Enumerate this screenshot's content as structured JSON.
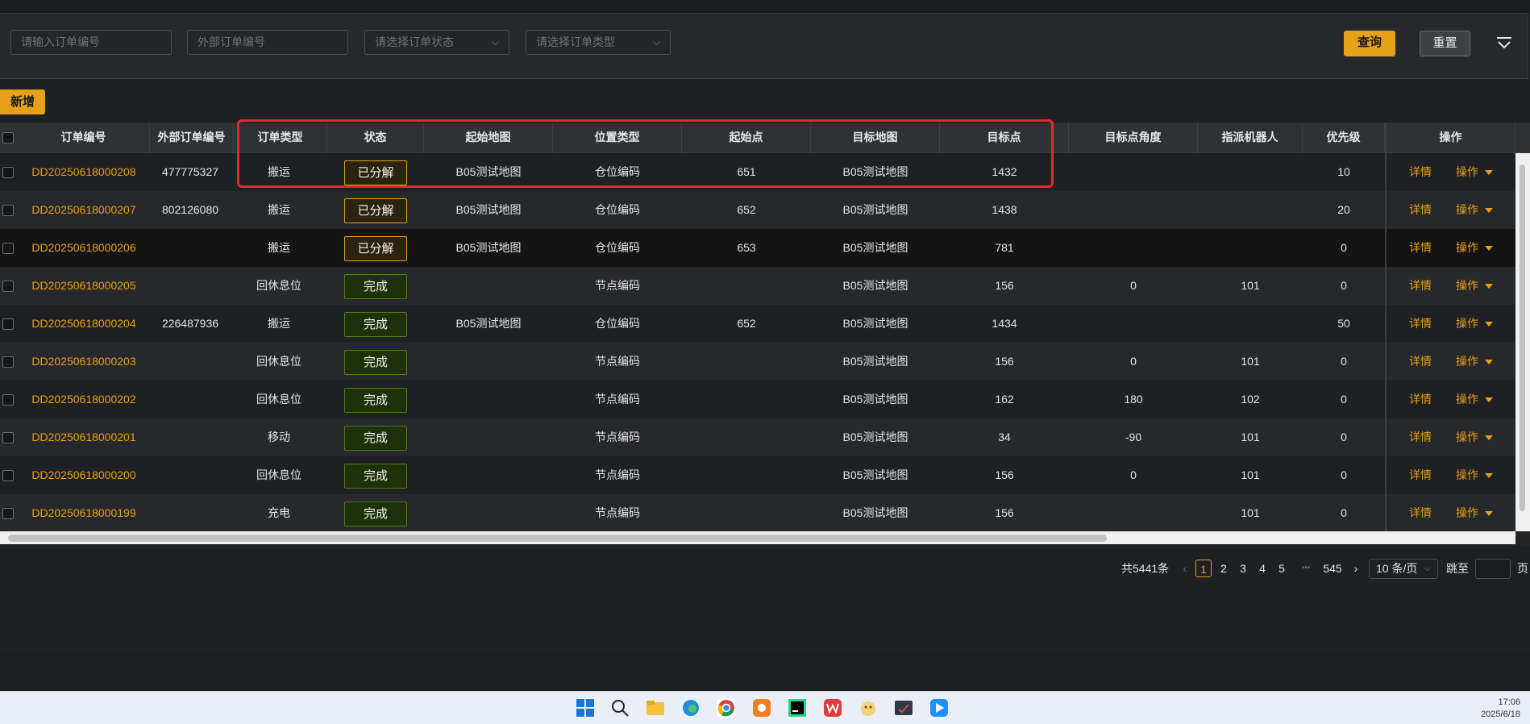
{
  "filter": {
    "order_no_placeholder": "请输入订单编号",
    "ext_order_placeholder": "外部订单编号",
    "status_placeholder": "请选择订单状态",
    "type_placeholder": "请选择订单类型",
    "query_label": "查询",
    "reset_label": "重置"
  },
  "toolbar": {
    "add_label": "新增"
  },
  "table": {
    "headers": [
      "订单编号",
      "外部订单编号",
      "订单类型",
      "状态",
      "起始地图",
      "位置类型",
      "起始点",
      "目标地图",
      "目标点",
      "目标点角度",
      "指派机器人",
      "优先级",
      "操作"
    ],
    "detail_label": "详情",
    "action_label": "操作",
    "rows": [
      {
        "id": "DD20250618000208",
        "ext": "477775327",
        "type": "搬运",
        "status": "已分解",
        "start_map": "B05测试地图",
        "pos_type": "仓位编码",
        "start": "651",
        "target_map": "B05测试地图",
        "target": "1432",
        "angle": "",
        "robot": "",
        "priority": "10"
      },
      {
        "id": "DD20250618000207",
        "ext": "802126080",
        "type": "搬运",
        "status": "已分解",
        "start_map": "B05测试地图",
        "pos_type": "仓位编码",
        "start": "652",
        "target_map": "B05测试地图",
        "target": "1438",
        "angle": "",
        "robot": "",
        "priority": "20"
      },
      {
        "id": "DD20250618000206",
        "ext": "",
        "type": "搬运",
        "status": "已分解",
        "start_map": "B05测试地图",
        "pos_type": "仓位编码",
        "start": "653",
        "target_map": "B05测试地图",
        "target": "781",
        "angle": "",
        "robot": "",
        "priority": "0"
      },
      {
        "id": "DD20250618000205",
        "ext": "",
        "type": "回休息位",
        "status": "完成",
        "start_map": "",
        "pos_type": "节点编码",
        "start": "",
        "target_map": "B05测试地图",
        "target": "156",
        "angle": "0",
        "robot": "101",
        "priority": "0"
      },
      {
        "id": "DD20250618000204",
        "ext": "226487936",
        "type": "搬运",
        "status": "完成",
        "start_map": "B05测试地图",
        "pos_type": "仓位编码",
        "start": "652",
        "target_map": "B05测试地图",
        "target": "1434",
        "angle": "",
        "robot": "",
        "priority": "50"
      },
      {
        "id": "DD20250618000203",
        "ext": "",
        "type": "回休息位",
        "status": "完成",
        "start_map": "",
        "pos_type": "节点编码",
        "start": "",
        "target_map": "B05测试地图",
        "target": "156",
        "angle": "0",
        "robot": "101",
        "priority": "0"
      },
      {
        "id": "DD20250618000202",
        "ext": "",
        "type": "回休息位",
        "status": "完成",
        "start_map": "",
        "pos_type": "节点编码",
        "start": "",
        "target_map": "B05测试地图",
        "target": "162",
        "angle": "180",
        "robot": "102",
        "priority": "0"
      },
      {
        "id": "DD20250618000201",
        "ext": "",
        "type": "移动",
        "status": "完成",
        "start_map": "",
        "pos_type": "节点编码",
        "start": "",
        "target_map": "B05测试地图",
        "target": "34",
        "angle": "-90",
        "robot": "101",
        "priority": "0"
      },
      {
        "id": "DD20250618000200",
        "ext": "",
        "type": "回休息位",
        "status": "完成",
        "start_map": "",
        "pos_type": "节点编码",
        "start": "",
        "target_map": "B05测试地图",
        "target": "156",
        "angle": "0",
        "robot": "101",
        "priority": "0"
      },
      {
        "id": "DD20250618000199",
        "ext": "",
        "type": "充电",
        "status": "完成",
        "start_map": "",
        "pos_type": "节点编码",
        "start": "",
        "target_map": "B05测试地图",
        "target": "156",
        "angle": "",
        "robot": "101",
        "priority": "0"
      }
    ]
  },
  "pagination": {
    "total": "共5441条",
    "pages": [
      "1",
      "2",
      "3",
      "4",
      "5"
    ],
    "ellipsis": "•••",
    "last": "545",
    "page_size": "10 条/页",
    "jump_label": "跳至",
    "page_suffix": "页"
  },
  "taskbar": {
    "time": "17:06",
    "date": "2025/6/18"
  },
  "colors": {
    "accent": "#e6a118",
    "highlight": "#e8262f",
    "done_bg": "#1e3109"
  }
}
